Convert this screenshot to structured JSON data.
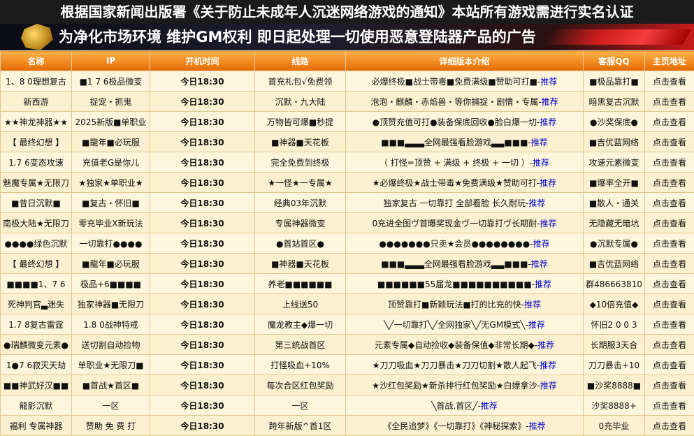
{
  "notice": "根据国家新闻出版署《关于防止未成年人沉迷网络游戏的通知》本站所有游戏需进行实名认证",
  "banner": "为净化市场环境  维护GM权利  即日起处理一切使用恶意登陆器产品的广告",
  "headers": [
    "名称",
    "IP",
    "开机时间",
    "线路",
    "详细版本介绍",
    "客服QQ",
    "主页地址"
  ],
  "recommend_label": "推荐",
  "home_label": "点击查看",
  "rows": [
    {
      "name": "1、8 0理想复古",
      "ip": "■1 7 6极品微变",
      "time": "今日18:30",
      "line": "首充礼包√免费领",
      "desc": "必爆终极■战士带毒■免费满级■赞助可打■-",
      "qq": "■极品靠打■"
    },
    {
      "name": "新西游",
      "ip": "捉宠・抓鬼",
      "time": "今日18:30",
      "line": "沉默・九大陆",
      "desc": "泡泡・麒麟・赤焰兽・等你捕捉・剧情・专属-",
      "qq": "暗黑复古沉默"
    },
    {
      "name": "★★神龙神器★★",
      "ip": "2025新版■单职业",
      "time": "今日18:30",
      "line": "万物皆可爆■秒提",
      "desc": "●顶赞充值可打●装备保底回收●脸白爆一切-",
      "qq": "●沙奖保底●"
    },
    {
      "name": "【   最终幻想   】",
      "ip": "■龍年■必玩服",
      "time": "今日18:30",
      "line": "■神器■天花板",
      "desc": "■■■▃▃▃全网最强看脸游戏▃▃■■■-",
      "qq": "■吉优蓝网络"
    },
    {
      "name": "1.7 6变态攻速",
      "ip": "充值老G是你儿",
      "time": "今日18:30",
      "line": "完全免费到终极",
      "desc": "（      打怪=顶赞 + 满级 + 终极 + 一切      ）-",
      "qq": "攻速元素微变"
    },
    {
      "name": "魅魔专属★无限刀",
      "ip": "★独家★单职业★",
      "time": "今日18:30",
      "line": "★一怪★一专属★",
      "desc": "★必爆终极★战士带毒★免费满级★赞助可打-",
      "qq": "■爆率全开■"
    },
    {
      "name": "■昔日沉默■",
      "ip": "■复古・怀旧■",
      "time": "今日18:30",
      "line": "经典03年沉默",
      "desc": "独家复古  一切靠打  全部看脸  长久耐玩-",
      "qq": "■散人・通关"
    },
    {
      "name": "南极大陆★无限刀",
      "ip": "零充毕业Ⅹ新玩法",
      "time": "今日18:30",
      "line": "专属神器微变",
      "desc": "0充进全图ヴ首曝奖现金ヴ一切靠打ヴ长期耐-",
      "qq": "无隐藏无暗坑"
    },
    {
      "name": "●●●●绿色沉默",
      "ip": "一切靠打●●●●",
      "time": "今日18:30",
      "line": "●首站首区●",
      "desc": "●●●●●●●只卖★会员●●●●●●●●-",
      "qq": "●沉默专属●"
    },
    {
      "name": "【   最终幻想   】",
      "ip": "■龍年■必玩服",
      "time": "今日18:30",
      "line": "■神器■天花板",
      "desc": "■■■▃▃▃全网最强看脸游戏▃▃■■■-",
      "qq": "■吉优蓝网络"
    },
    {
      "name": "■■■■1、7 6",
      "ip": "极品+6■■■■",
      "time": "今日18:30",
      "line": "养老■■■■■■",
      "desc": "■■■■■■55届龙■■■■■■■■■■-",
      "qq": "群486663810"
    },
    {
      "name": "死神判官▃迷失",
      "ip": "独家神器■无限刀",
      "time": "今日18:30",
      "line": "上线送50",
      "desc": "顶赞靠打■新颖玩法■打的比充的快-",
      "qq": "◆10倍充值◆"
    },
    {
      "name": "1.7 8复古雷霆",
      "ip": "1.8 0战神特戒",
      "time": "今日18:30",
      "line": "魔龙教主◆爆一切",
      "desc": "╲╱一切靠打╲╱全网独家╲╱无GM模式╲-",
      "qq": "怀旧2 0 0 3"
    },
    {
      "name": "●瑞麟微变元素●",
      "ip": "送切割自动捡物",
      "time": "今日18:30",
      "line": "第三统战首区",
      "desc": "元素专属◆自动捡收◆装备保值◆非常长期◆-",
      "qq": "长期服3天合"
    },
    {
      "name": "1●7 6寂灭天劫",
      "ip": "单职业★无限刀■",
      "time": "今日18:30",
      "line": "打怪吸血+10%",
      "desc": "★刀刀吸血★刀刀暴击★刀刀切割★散人起飞-",
      "qq": "刀刀暴击+10"
    },
    {
      "name": "■■神武好汉■■",
      "ip": "■首战★首区■",
      "time": "今日18:30",
      "line": "每次合区红包奖励",
      "desc": "★沙红包奖励★新杀排行红包奖励★白嫖拿沙-",
      "qq": "■沙奖8888■"
    },
    {
      "name": "龍影沉默",
      "ip": "一区",
      "time": "今日18:30",
      "line": "一区",
      "desc": "╲首战.首区╱-",
      "qq": "沙奖8888+"
    },
    {
      "name": "福利   专属神器",
      "ip": "赞助   免   费   打",
      "time": "今日18:30",
      "line": "跨年新版^首1区",
      "desc": "《全民追梦》《一切靠打》《神秘探索》-",
      "qq": "0充毕业"
    }
  ]
}
